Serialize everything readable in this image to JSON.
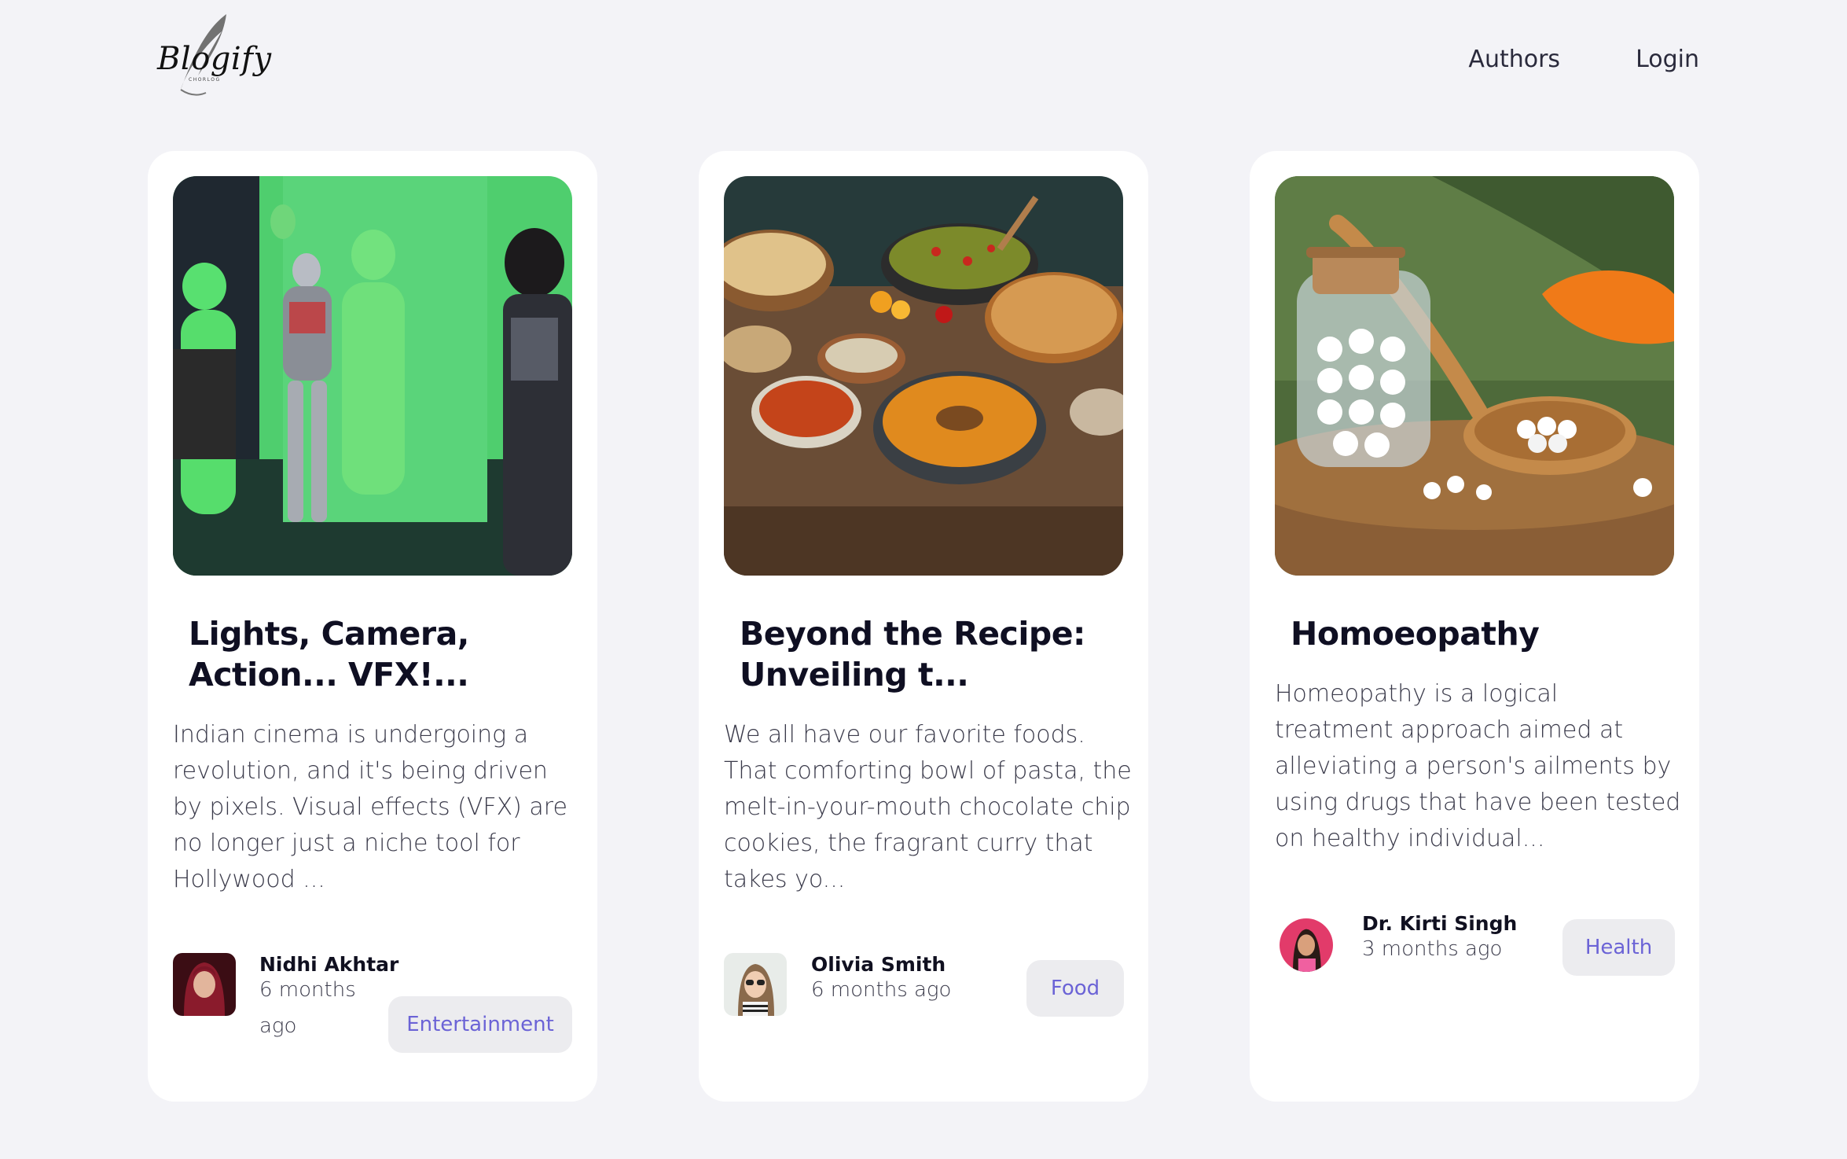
{
  "brand": {
    "name": "Blogify",
    "tagline": "CHORLOG"
  },
  "nav": {
    "authors": "Authors",
    "login": "Login"
  },
  "posts": [
    {
      "title": "Lights, Camera, Action... VFX!...",
      "excerpt": "Indian cinema is undergoing a revolution, and it's being driven by pixels. Visual effects (VFX) are no longer just a niche tool for Hollywood ...",
      "author": "Nidhi Akhtar",
      "time": "6 months ago",
      "tag": "Entertainment"
    },
    {
      "title": "Beyond the Recipe: Unveiling t...",
      "excerpt": "We all have our favorite foods. That comforting bowl of pasta, the melt-in-your-mouth chocolate chip cookies, the fragrant curry that takes yo...",
      "author": "Olivia Smith",
      "time": "6 months ago",
      "tag": "Food"
    },
    {
      "title": "Homoeopathy",
      "excerpt": "Homeopathy is a logical treatment approach aimed at alleviating a person's ailments by using drugs that have been tested on healthy individual...",
      "author": "Dr. Kirti Singh",
      "time": "3 months ago",
      "tag": "Health"
    }
  ],
  "colors": {
    "background": "#f3f3f7",
    "card": "#ffffff",
    "tag_text": "#6b63d6",
    "tag_bg": "#ececef"
  }
}
